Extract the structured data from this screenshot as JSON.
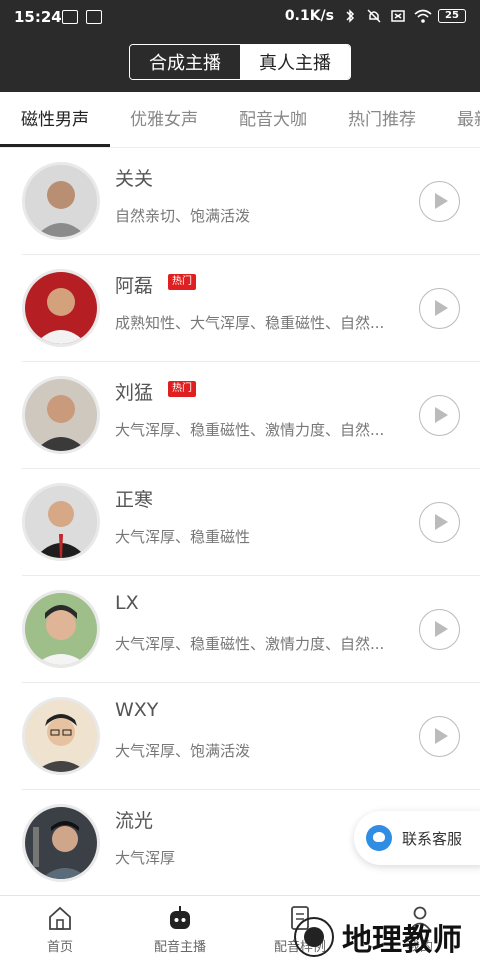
{
  "status": {
    "time": "15:24",
    "speed": "0.1K/s",
    "battery": "25"
  },
  "header": {
    "segments": [
      "合成主播",
      "真人主播"
    ]
  },
  "tabs": [
    "磁性男声",
    "优雅女声",
    "配音大咖",
    "热门推荐",
    "最新"
  ],
  "hot_label": "热门",
  "anchors": [
    {
      "name": "关关",
      "desc": "自然亲切、饱满活泼",
      "hot": false
    },
    {
      "name": "阿磊",
      "desc": "成熟知性、大气浑厚、稳重磁性、自然...",
      "hot": true
    },
    {
      "name": "刘猛",
      "desc": "大气浑厚、稳重磁性、激情力度、自然...",
      "hot": true
    },
    {
      "name": "正寒",
      "desc": "大气浑厚、稳重磁性",
      "hot": false
    },
    {
      "name": "LX",
      "desc": "大气浑厚、稳重磁性、激情力度、自然...",
      "hot": false
    },
    {
      "name": "WXY",
      "desc": "大气浑厚、饱满活泼",
      "hot": false
    },
    {
      "name": "流光",
      "desc": "大气浑厚",
      "hot": false
    }
  ],
  "service": {
    "label": "联系客服"
  },
  "nav": [
    "首页",
    "配音主播",
    "配音样例",
    "我的"
  ],
  "watermark": "地理教师",
  "colors": {
    "header_bg": "#2b2b2b",
    "hot_badge": "#e02020",
    "service_icon": "#2f8de4"
  }
}
